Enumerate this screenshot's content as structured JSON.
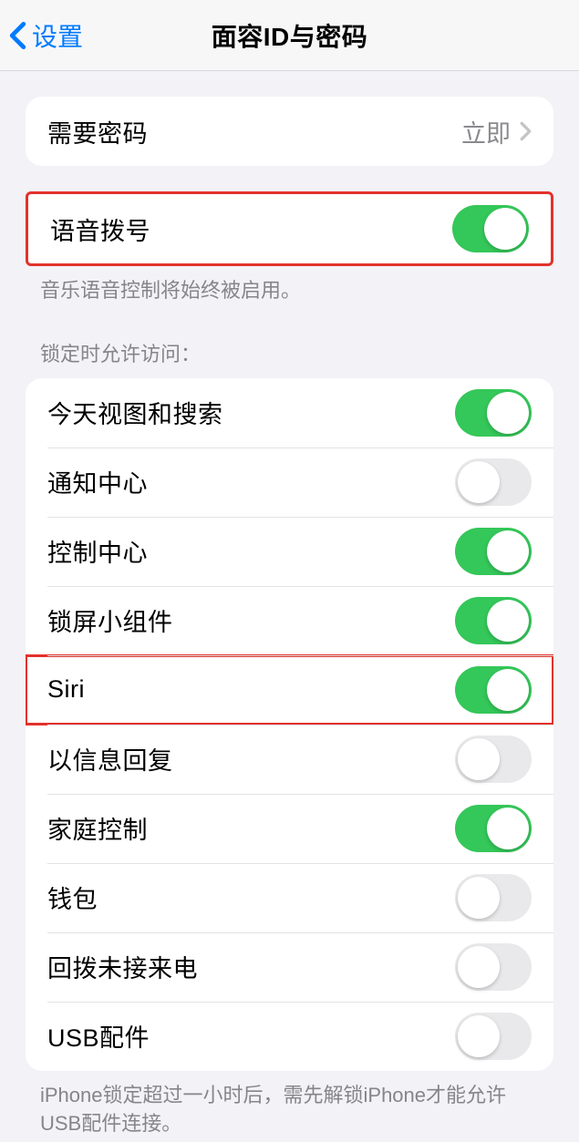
{
  "nav": {
    "back_label": "设置",
    "title": "面容ID与密码"
  },
  "passcode": {
    "label": "需要密码",
    "value": "立即"
  },
  "voice_dial": {
    "label": "语音拨号",
    "enabled": true,
    "footer": "音乐语音控制将始终被启用。"
  },
  "lock_access": {
    "header": "锁定时允许访问：",
    "items": [
      {
        "label": "今天视图和搜索",
        "enabled": true
      },
      {
        "label": "通知中心",
        "enabled": false
      },
      {
        "label": "控制中心",
        "enabled": true
      },
      {
        "label": "锁屏小组件",
        "enabled": true
      },
      {
        "label": "Siri",
        "enabled": true,
        "highlighted": true
      },
      {
        "label": "以信息回复",
        "enabled": false
      },
      {
        "label": "家庭控制",
        "enabled": true
      },
      {
        "label": "钱包",
        "enabled": false
      },
      {
        "label": "回拨未接来电",
        "enabled": false
      },
      {
        "label": "USB配件",
        "enabled": false
      }
    ],
    "footer": "iPhone锁定超过一小时后，需先解锁iPhone才能允许USB配件连接。"
  }
}
